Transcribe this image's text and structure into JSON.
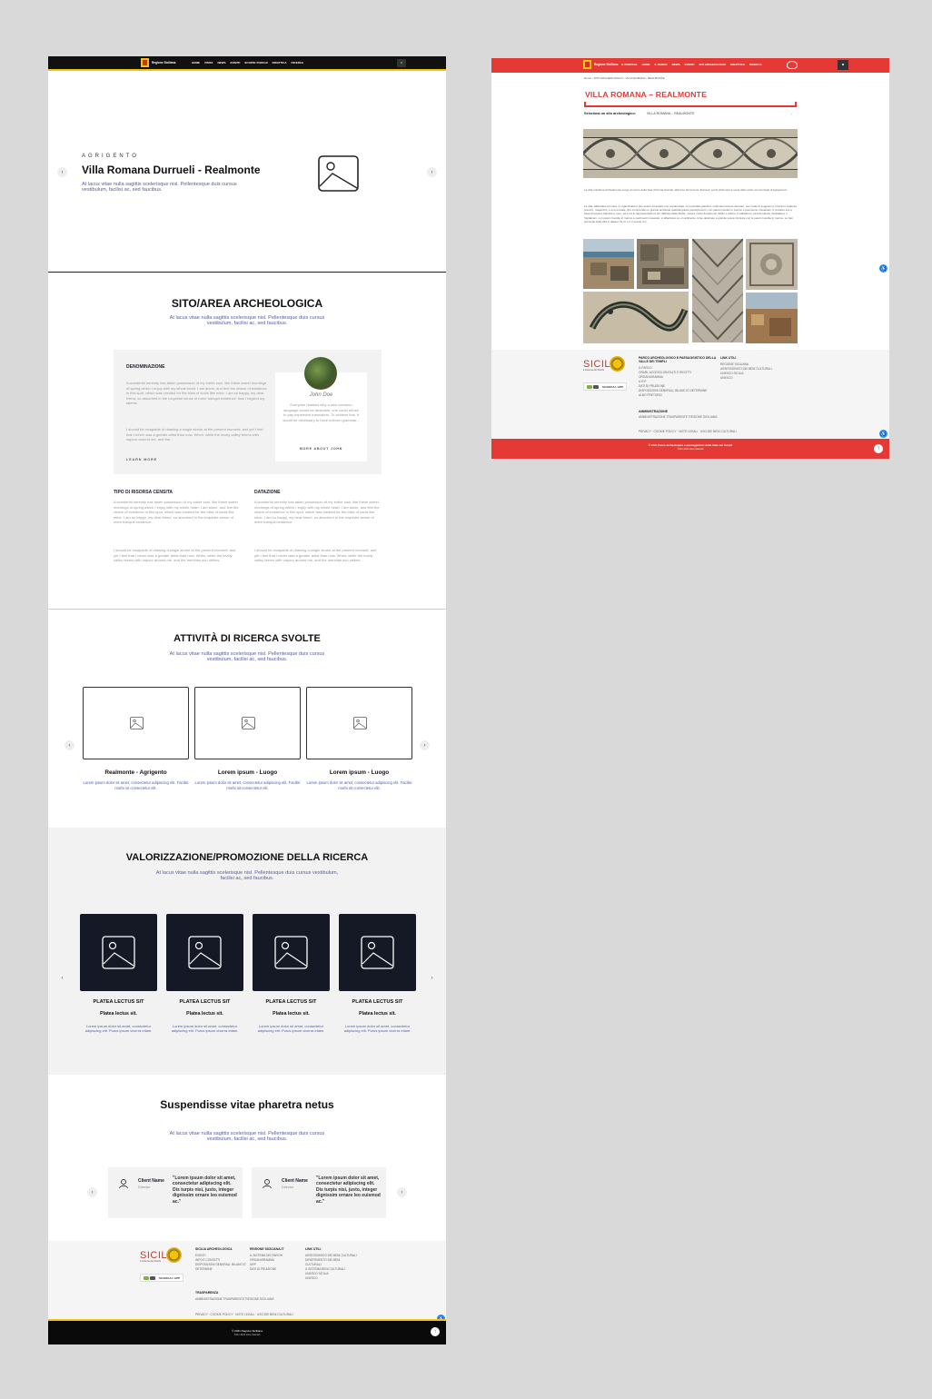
{
  "left": {
    "nav": {
      "brand": "Regione Siciliana",
      "menu": [
        "HOME",
        "VISITA",
        "NEWS",
        "EVENTI",
        "SCOPRI I PARCHI",
        "DIDATTICA",
        "RICERCA"
      ]
    },
    "hero": {
      "eyebrow": "AGRIGENTO",
      "title": "Villa Romana Durrueli - Realmonte",
      "subtitle": "At lacus vitae nulla sagittis scelerisque nisl. Pellentesque duis cursus vestibulum, facilisi ac, sed faucibus.",
      "prev": "‹",
      "next": "›"
    },
    "sito": {
      "title": "SITO/AREA ARCHEOLOGICA",
      "subtitle": "At lacus vitae nulla sagittis scelerisque nisl. Pellentesque duis cursus vestibulum, facilisi ac, sed faucibus.",
      "denominazione": {
        "title": "DENOMINAZIONE",
        "text1": "A wonderful serenity has taken possession of my entire soul, like these sweet mornings of spring which I enjoy with my whole heart. I am alone, and feel the charm of existence in this spot, which was created for the bliss of souls like mine. I am so happy, my dear friend, so absorbed in the exquisite sense of mere tranquil existence, that I neglect my talents.",
        "text2": "I should be incapable of drawing a single stroke at the present moment; and yet I feel that I never was a greater artist than now. When, while the lovely valley teems with vapour around me, and the...",
        "link": "LEARN MORE"
      },
      "person": {
        "name": "John Doe",
        "bio": "Everyone realizes why a new common language would be desirable: one could refuse to pay expensive translators. To achieve this, it would be necessary to have uniform grammar...",
        "link": "MORE ABOUT JOHN"
      },
      "tipo": {
        "title": "TIPO DI RISORSA CENSITA",
        "text1": "A wonderful serenity has taken possession of my entire soul, like these sweet mornings of spring which I enjoy with my whole heart. I am alone, and feel the charm of existence in this spot, which was created for the bliss of souls like mine. I am so happy, my dear friend, so absorbed in the exquisite sense of mere tranquil existence.",
        "text2": "I should be incapable of drawing a single stroke at the present moment; and yet I feel that I never was a greater artist than now. When, while the lovely valley teems with vapour around me, and the meridian sun strikes."
      },
      "datazione": {
        "title": "DATAZIONE",
        "text1": "A wonderful serenity has taken possession of my entire soul, like these sweet mornings of spring which I enjoy with my whole heart. I am alone, and feel the charm of existence in this spot, which was created for the bliss of souls like mine. I am so happy, my dear friend, so absorbed in the exquisite sense of mere tranquil existence.",
        "text2": "I should be incapable of drawing a single stroke at the present moment; and yet I feel that I never was a greater artist than now. When, while the lovely valley teems with vapour around me, and the meridian sun strikes."
      }
    },
    "attivita": {
      "title": "ATTIVITÀ DI RICERCA SVOLTE",
      "subtitle": "At lacus vitae nulla sagittis scelerisque nisl. Pellentesque duis cursus vestibulum, facilisi ac, sed faucibus.",
      "cards": [
        {
          "title": "Realmonte - Agrigento",
          "text": "Lorem ipsum dolor sit amet, consectetur adipiscing elit. Facilisi morbi sit consectetur elit."
        },
        {
          "title": "Lorem ipsum - Luogo",
          "text": "Lorem ipsum dolor sit amet, consectetur adipiscing elit. Facilisi morbi sit consectetur elit."
        },
        {
          "title": "Lorem ipsum - Luogo",
          "text": "Lorem ipsum dolor sit amet, consectetur adipiscing elit. Facilisi morbi sit consectetur elit."
        }
      ]
    },
    "valorizzazione": {
      "title": "VALORIZZAZIONE/PROMOZIONE  DELLA RICERCA",
      "subtitle": "At lacus vitae nulla sagittis scelerisque nisl. Pellentesque duis cursus vestibulum, facilisi ac, sed faucibus.",
      "cards": [
        {
          "title": "PLATEA LECTUS SIT",
          "sub": "Platea lectus sit.",
          "text": "Lorem ipsum dolor sit amet, consectetur adipiscing elit. Purus ipsum viverra etiam."
        },
        {
          "title": "PLATEA LECTUS SIT",
          "sub": "Platea lectus sit.",
          "text": "Lorem ipsum dolor sit amet, consectetur adipiscing elit. Purus ipsum viverra etiam."
        },
        {
          "title": "PLATEA LECTUS SIT",
          "sub": "Platea lectus sit.",
          "text": "Lorem ipsum dolor sit amet, consectetur adipiscing elit. Purus ipsum viverra etiam."
        },
        {
          "title": "PLATEA LECTUS SIT",
          "sub": "Platea lectus sit.",
          "text": "Lorem ipsum dolor sit amet, consectetur adipiscing elit. Purus ipsum viverra etiam."
        }
      ]
    },
    "testimonials": {
      "title": "Suspendisse vitae pharetra netus",
      "subtitle": "At lacus vitae nulla sagittis scelerisque nisl. Pellentesque duis cursus vestibulum, facilisi ac, sed faucibus.",
      "items": [
        {
          "name": "Client Name",
          "role": "Director",
          "quote": "\"Lorem ipsum dolor sit amet, consectetur adipiscing elit. Dis turpis nisi, justo, integer dignissim ornare leo euismod ac.\""
        },
        {
          "name": "Client Name",
          "role": "Director",
          "quote": "\"Lorem ipsum dolor sit amet, consectetur adipiscing elit. Dis turpis nisi, justo, integer dignissim ornare leo euismod ac.\""
        }
      ]
    },
    "footer": {
      "logo_word": "SICILIA",
      "logo_tag": "il sistema dei Parchi",
      "app_label": "SCARICA L'APP",
      "col1_title": "SICILIA ARCHEOLOGICA",
      "col1_items": [
        "EVENTI",
        "INFO E CONTATTI",
        "DISPOSIZIONI GENERALI, BILANCI E",
        "DETERMINE"
      ],
      "col2_title": "REGIONE SICILIANA.IT",
      "col2_items": [
        "IL SISTEMA DEI PARCHI",
        "ORGANIGRAMMA",
        "URP",
        "DATI DI FRUIZIONE"
      ],
      "col3_title": "LINK UTILI",
      "col3_items": [
        "ASSESSORATO DEI BENI CULTURALI",
        "DIPARTIMENTO DEI BENI",
        "CULTURALI",
        "IL SISTEMA BENI CULTURALI",
        "UNESCO SICILIA",
        "UNESCO"
      ],
      "trasp_title": "TRASPARENZA",
      "trasp_item": "AMMINISTRAZIONE TRASPARENTE 'REGIONE SICILIANA'",
      "legal": "PRIVACY · COOKIE POLICY · NOTE LEGALI · USO DEI BENI CULTURALI",
      "copy1": "© 2021 Regione Siciliana",
      "copy2": "Tutti i diritti sono riservati"
    }
  },
  "right": {
    "nav": {
      "brand": "Regione Siciliana",
      "menu": [
        "IL PORTALE",
        "HOME",
        "IL PARCO",
        "NEWS",
        "EVENTI",
        "SITI ARCHEOLOGICI",
        "DIDATTICA",
        "RICERCA"
      ]
    },
    "breadcrumb": "Home  ›  SITO ARCHEOLOGICO  ›  VILLA ROMANA  ›  REALMONTE",
    "title": "VILLA ROMANA – REALMONTE",
    "select_label": "Seleziona un sito archeologico:",
    "select_value": "VILLA ROMANA – REALMONTE",
    "para1": "La villa marittima di Realmonte sorge al centro della baia di Punta Grande, alla foce del torrente Durrueli, pochi chilometri a ovest dello scalo commerciale di Agrigentum.",
    "para2": "La villa, affacciata sul mare, è organizzata in due settori principali: uno residenziale, con peristilio-giardino, cubicula (camere da letto), oeci (sale di soggiorno), triclinium (sala da pranzo), magazzini, e uno termale, che comprende un grande ambiente quadrangolare (apodyterium), con pareti rivestite in marmo e pavimento mosaicato. Il mosaico era a base di tessere bianche e nere, ed è tra le rappresentazioni più raffinate della Sicilia, mostra motivi floreali con delfini e anfore. Il calidarium, piccola stanza riscaldata e il frigidarium, con pareti rivestite in marmo e pavimenti mosaicati, si affacciano su un ambiente, forse destinato a grande vasca circolare con le pareti rivestite in marmo. Le fasi principali della villa si datano fra il I e il V secolo d.C.",
    "footer": {
      "logo_word": "SICILIA",
      "logo_tag": "il sistema dei Parchi",
      "app_label": "SCARICA L'APP",
      "col1_title": "PARCO ARCHEOLOGICO E PAESAGGISTICO DELLA VALLE DEI TEMPLI",
      "col1_items": [
        "IL PARCO",
        "ORARI, ACCESSI GRATUITI E RIDOTTI",
        "ORGANIGRAMMA",
        "U.R.P.",
        "DATI DI FRUIZIONE",
        "DISPOSIZIONI GENERALI, BILANCI E DETERMINE",
        "ALBO PRETORIO"
      ],
      "admin_title": "AMMINISTRAZIONE",
      "admin_item": "AMMINISTRAZIONE TRASPARENTE 'REGIONE SICILIANA'",
      "col2_title": "LINK UTILI",
      "col2_items": [
        "REGIONE SICILIANA",
        "ASSESSORATO DEI BENI CULTURALI",
        "UNESCO SICILIA",
        "UNESCO"
      ],
      "legal": "PRIVACY · COOKIE POLICY · NOTE LEGALI · USO DEI BENI CULTURALI",
      "copy1": "© 2021 Parco archeologico e paesaggistico della Valle dei Templi",
      "copy2": "Tutti i diritti sono riservati"
    }
  },
  "colors": {
    "accent_yellow": "#f4c20d",
    "accent_red": "#e53935",
    "dark_card": "#141925",
    "muted_blue_text": "#5560a0"
  }
}
